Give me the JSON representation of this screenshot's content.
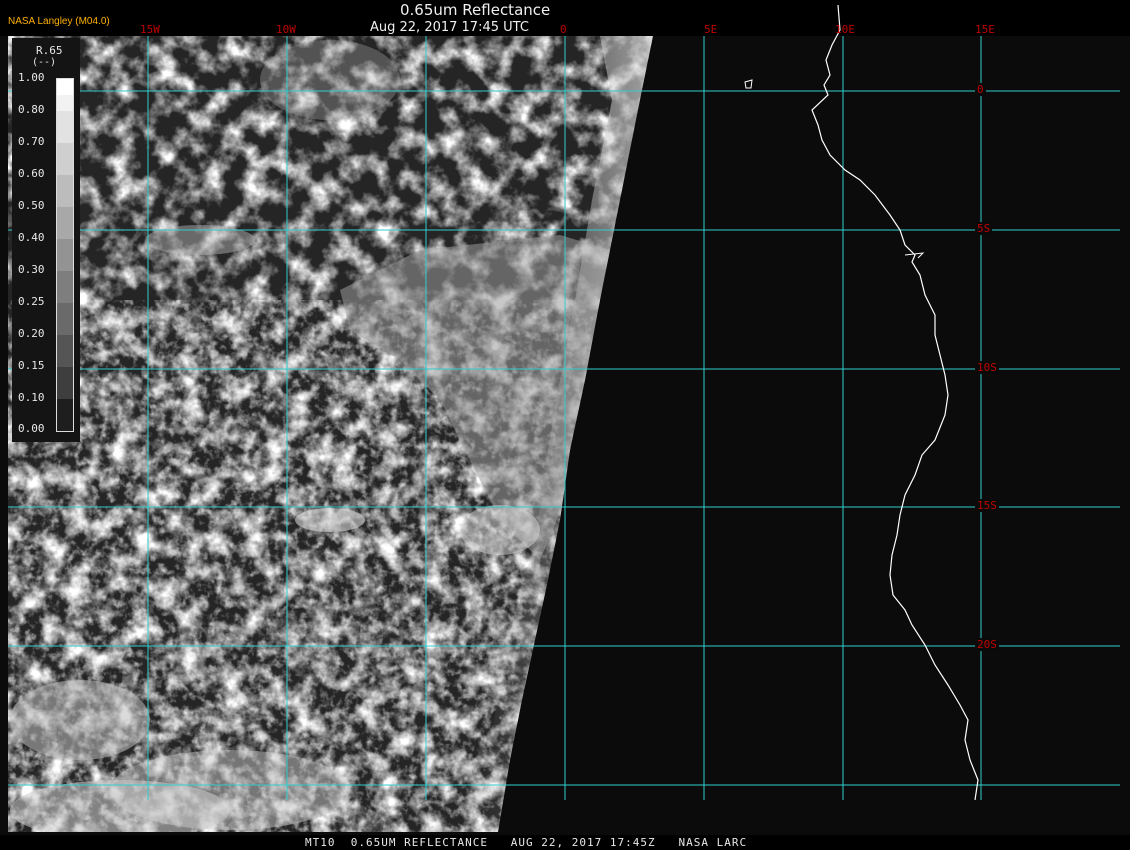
{
  "header": {
    "credit": "NASA Langley (M04.0)",
    "title": "0.65um Reflectance",
    "subtitle": "Aug 22, 2017 17:45 UTC"
  },
  "legend": {
    "name": "R.65",
    "unit": "(--)",
    "ticks": [
      "1.00",
      "0.80",
      "0.70",
      "0.60",
      "0.50",
      "0.40",
      "0.30",
      "0.25",
      "0.20",
      "0.15",
      "0.10",
      "0.00"
    ]
  },
  "grid": {
    "lon_labels": [
      "15W",
      "10W",
      "0",
      "5E",
      "10E",
      "15E"
    ],
    "lat_labels": [
      "0",
      "5S",
      "10S",
      "15S",
      "20S"
    ]
  },
  "footer": {
    "text": "MT10  0.65UM REFLECTANCE   AUG 22, 2017 17:45Z   NASA LARC"
  },
  "colors": {
    "grid": "#33cccc",
    "labels": "#c00000",
    "credit": "#ffb000",
    "coast": "#ffffff",
    "space": "#0b0b0b"
  }
}
